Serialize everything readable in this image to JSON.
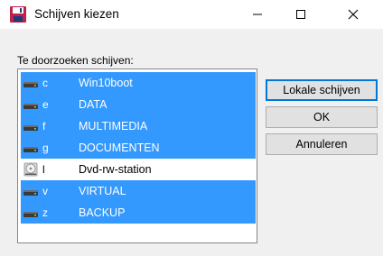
{
  "window": {
    "title": "Schijven kiezen",
    "minimize_glyph": "—",
    "maximize_glyph": "☐",
    "close_glyph": "✕"
  },
  "list_label": "Te doorzoeken schijven:",
  "drives": [
    {
      "letter": "c",
      "name": "Win10boot",
      "icon": "hard-drive-icon",
      "selected": true
    },
    {
      "letter": "e",
      "name": "DATA",
      "icon": "hard-drive-icon",
      "selected": true
    },
    {
      "letter": "f",
      "name": "MULTIMEDIA",
      "icon": "hard-drive-icon",
      "selected": true
    },
    {
      "letter": "g",
      "name": "DOCUMENTEN",
      "icon": "hard-drive-icon",
      "selected": true
    },
    {
      "letter": "l",
      "name": "Dvd-rw-station",
      "icon": "optical-drive-icon",
      "selected": false
    },
    {
      "letter": "v",
      "name": "VIRTUAL",
      "icon": "hard-drive-icon",
      "selected": true
    },
    {
      "letter": "z",
      "name": "BACKUP",
      "icon": "hard-drive-icon",
      "selected": true
    }
  ],
  "buttons": {
    "local_drives": "Lokale schijven",
    "ok": "OK",
    "cancel": "Annuleren"
  },
  "colors": {
    "selection": "#3399ff",
    "default_button_border": "#0078d7"
  }
}
